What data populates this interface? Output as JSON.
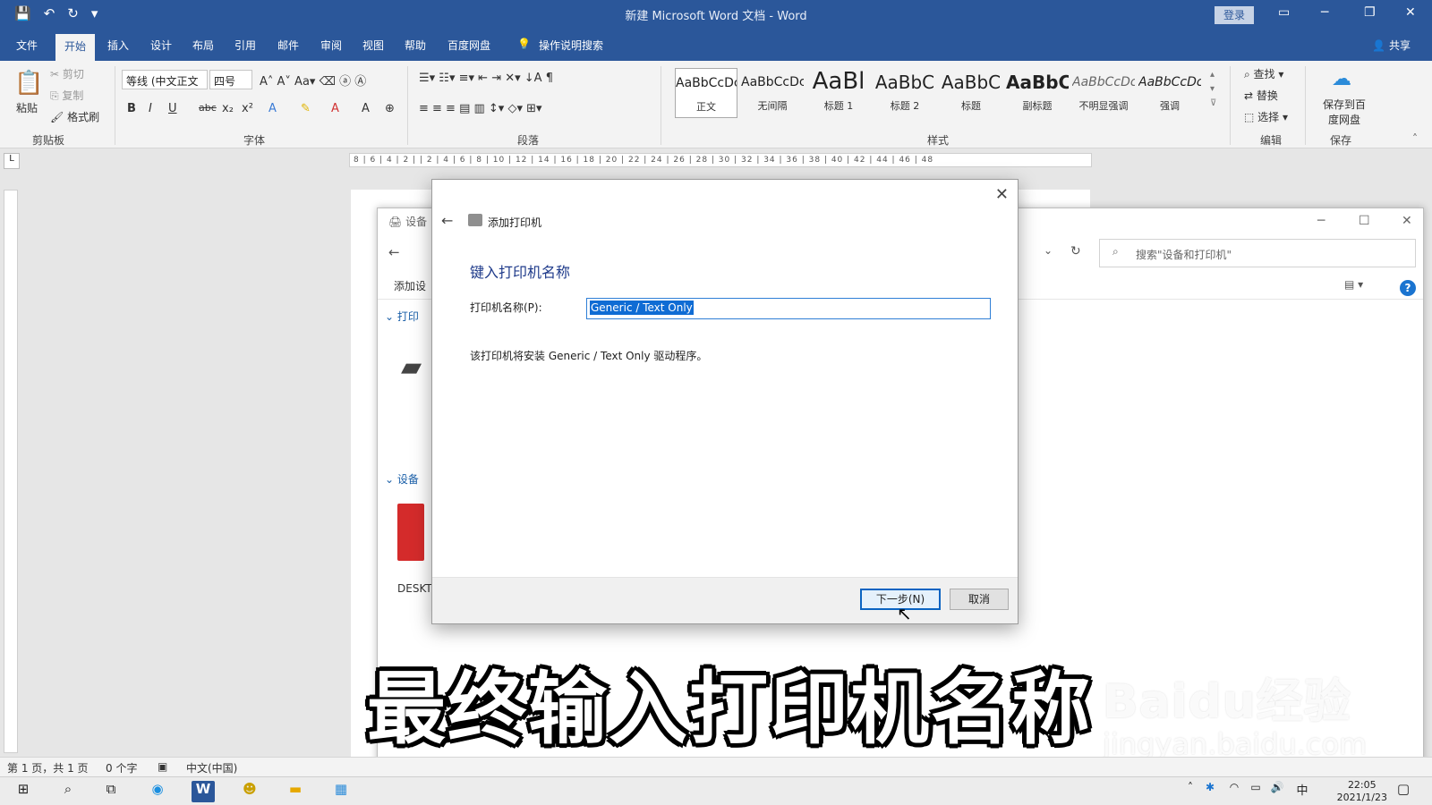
{
  "window": {
    "title": "新建 Microsoft Word 文档 - Word",
    "login_label": "登录",
    "minimize": "─",
    "restore": "❐",
    "close": "✕"
  },
  "tabs": {
    "file": "文件",
    "home": "开始",
    "insert": "插入",
    "design": "设计",
    "layout": "布局",
    "references": "引用",
    "mailings": "邮件",
    "review": "审阅",
    "view": "视图",
    "help": "帮助",
    "baidu": "百度网盘",
    "tell": "操作说明搜索",
    "share": "共享"
  },
  "ribbon": {
    "clipboard": {
      "paste": "粘贴",
      "cut": "剪切",
      "copy": "复制",
      "format_painter": "格式刷",
      "label": "剪贴板"
    },
    "font": {
      "name": "等线 (中文正文",
      "size": "四号",
      "label": "字体"
    },
    "paragraph": {
      "label": "段落"
    },
    "styles": {
      "label": "样式",
      "items": [
        {
          "sample": "AaBbCcDc",
          "name": "正文"
        },
        {
          "sample": "AaBbCcDc",
          "name": "无间隔"
        },
        {
          "sample": "AaBl",
          "name": "标题 1"
        },
        {
          "sample": "AaBbC",
          "name": "标题 2"
        },
        {
          "sample": "AaBbC",
          "name": "标题"
        },
        {
          "sample": "AaBbC",
          "name": "副标题"
        },
        {
          "sample": "AaBbCcDc",
          "name": "不明显强调"
        },
        {
          "sample": "AaBbCcDc",
          "name": "强调"
        }
      ]
    },
    "editing": {
      "find": "查找",
      "replace": "替换",
      "select": "选择",
      "label": "编辑"
    },
    "save": {
      "button": "保存到百度网盘",
      "label": "保存"
    }
  },
  "ruler": {
    "ticks": "8 | 6 | 4 | 2 | | 2 | 4 | 6 | 8 | 10 | 12 | 14 | 16 | 18 | 20 | 22 | 24 | 26 | 28 | 30 | 32 | 34 | 36 | 38 | 40 | 42 | 44 | 46 | 48"
  },
  "explorer": {
    "title_fragment": "设备",
    "search_placeholder": "搜索\"设备和打印机\"",
    "add_fragment": "添加设",
    "printers_section": "打印",
    "devices_section": "设备",
    "device_label": "DESKT"
  },
  "dialog": {
    "window_title": "添加打印机",
    "heading": "键入打印机名称",
    "field_label": "打印机名称(P):",
    "field_value": "Generic / Text Only",
    "info": "该打印机将安装 Generic / Text Only 驱动程序。",
    "next_button": "下一步(N)",
    "cancel_button": "取消"
  },
  "caption": "最终输入打印机名称",
  "watermark": {
    "logo": "Baidu经验",
    "url": "jingyan.baidu.com"
  },
  "status": {
    "page": "第 1 页，共 1 页",
    "words": "0 个字",
    "language": "中文(中国)"
  },
  "taskbar": {
    "ime": "中",
    "time": "22:05",
    "date": "2021/1/23"
  }
}
